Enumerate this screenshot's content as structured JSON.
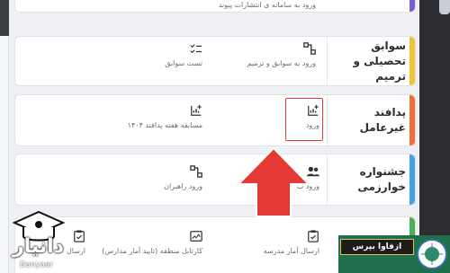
{
  "rows": [
    {
      "category": "",
      "accent": "#7c5cd6",
      "items": [
        {
          "label": "ورود به سامانه ی انتشارات پیوند",
          "icon": "login-icon"
        }
      ]
    },
    {
      "category": "سوابق تحصیلی و ترمیم",
      "accent": "#f2c230",
      "items": [
        {
          "label": "ورود به سوابق و ترمیم",
          "icon": "network-icon"
        },
        {
          "label": "تست سوابق",
          "icon": "checklist-icon"
        }
      ]
    },
    {
      "category": "پدافند غیرعامل",
      "accent": "#f26b3a",
      "items": [
        {
          "label": "ورود",
          "icon": "chart-add-icon"
        },
        {
          "label": "مسابقه هفته پدافند ۱۴۰۴",
          "icon": "chart-add-icon"
        }
      ]
    },
    {
      "category": "جشنواره خوارزمی",
      "accent": "#3fa3e6",
      "items": [
        {
          "label": "ورود ب",
          "icon": "users-icon"
        },
        {
          "label": "ورود راهبران",
          "icon": "network-icon"
        }
      ]
    },
    {
      "category": "",
      "accent": "#4caf50",
      "items": [
        {
          "label": "ارسال آمار مدرسه",
          "icon": "clipboard-check-icon"
        },
        {
          "label": "کارتابل منطقه (تایید آمار مدارس)",
          "icon": "image-check-icon"
        },
        {
          "label": "ارسال",
          "icon": "clipboard-check-icon"
        }
      ]
    }
  ],
  "watermark": {
    "name": "دانیار",
    "sub": "Danyaar"
  },
  "brand": {
    "label": "ازفاوا بپرس"
  },
  "colors": {
    "highlight": "#e53935",
    "arrow": "#e53935"
  }
}
